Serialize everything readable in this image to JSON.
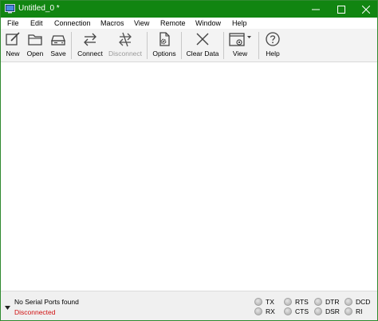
{
  "window": {
    "title": "Untitled_0 *",
    "titlebar_color": "#118511"
  },
  "menu": [
    "File",
    "Edit",
    "Connection",
    "Macros",
    "View",
    "Remote",
    "Window",
    "Help"
  ],
  "toolbar": {
    "new": "New",
    "open": "Open",
    "save": "Save",
    "connect": "Connect",
    "disconnect": "Disconnect",
    "options": "Options",
    "clear_data": "Clear Data",
    "view": "View",
    "help": "Help"
  },
  "status": {
    "port": "No Serial Ports found",
    "connection": "Disconnected",
    "connection_color": "#d01010",
    "signals": [
      "TX",
      "RX",
      "RTS",
      "CTS",
      "DTR",
      "DSR",
      "DCD",
      "RI"
    ]
  }
}
